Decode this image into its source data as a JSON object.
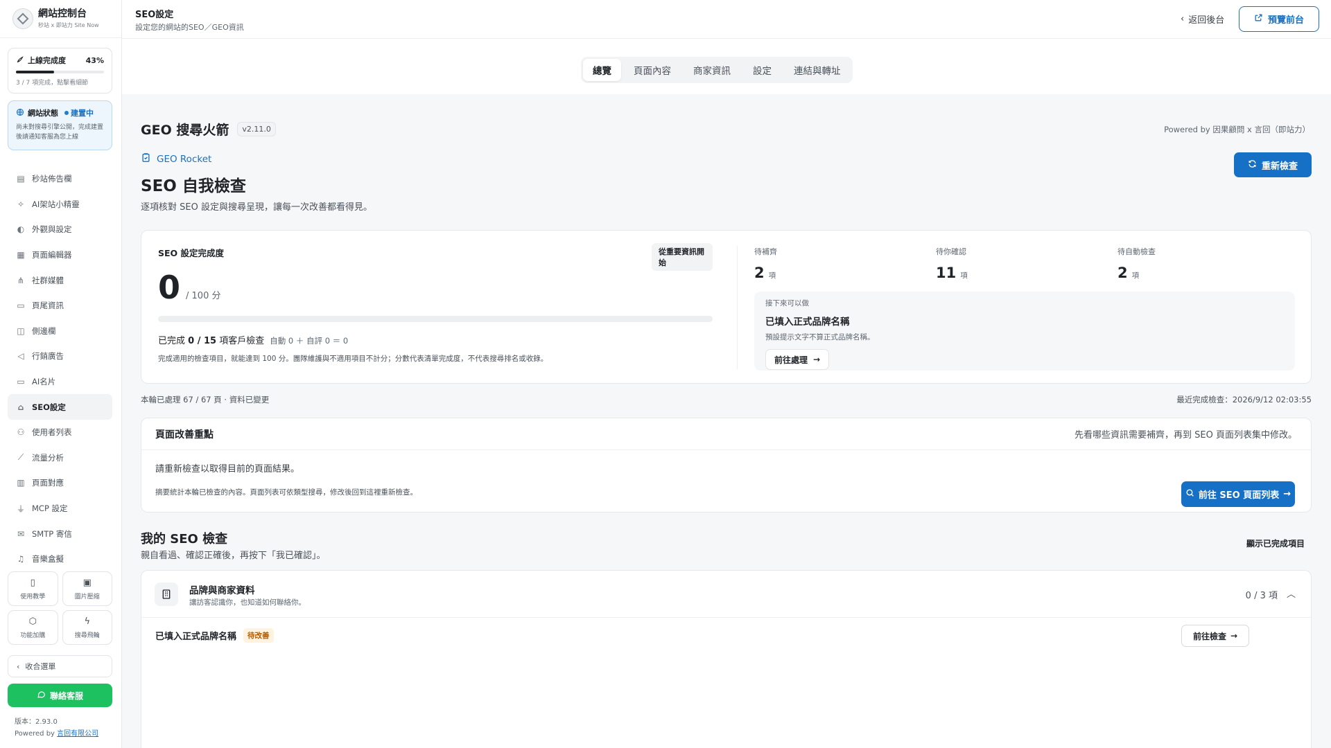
{
  "sidebar": {
    "brand_title": "網站控制台",
    "brand_sub": "秒站 x 即站力 Site Now",
    "progress": {
      "title": "上線完成度",
      "percent_label": "43%",
      "percent": 0.43,
      "note": "3 / 7 項完成，點擊看細節"
    },
    "status": {
      "title": "網站狀態",
      "badge": "建置中",
      "note": "尚未對搜尋引擎公開，完成建置後請通知客服為您上線"
    },
    "items": [
      {
        "label": "秒站佈告欄",
        "icon": "clipboard-icon"
      },
      {
        "label": "AI架站小精靈",
        "icon": "sparkle-icon"
      },
      {
        "label": "外觀與設定",
        "icon": "palette-icon"
      },
      {
        "label": "頁面編輯器",
        "icon": "layout-icon"
      },
      {
        "label": "社群媒體",
        "icon": "share-icon"
      },
      {
        "label": "頁尾資訊",
        "icon": "footer-icon"
      },
      {
        "label": "側邊欄",
        "icon": "sidebar-icon"
      },
      {
        "label": "行銷廣告",
        "icon": "megaphone-icon"
      },
      {
        "label": "AI名片",
        "icon": "card-icon"
      },
      {
        "label": "SEO設定",
        "icon": "rocket-icon",
        "active": true
      },
      {
        "label": "使用者列表",
        "icon": "users-icon"
      },
      {
        "label": "流量分析",
        "icon": "chart-icon"
      },
      {
        "label": "頁面對應",
        "icon": "map-icon"
      },
      {
        "label": "MCP 設定",
        "icon": "plug-icon"
      },
      {
        "label": "SMTP 寄信",
        "icon": "mail-icon"
      },
      {
        "label": "音樂盒擬",
        "icon": "music-icon"
      }
    ],
    "tiles": [
      {
        "label": "使用教學",
        "icon": "book-icon"
      },
      {
        "label": "圖片壓縮",
        "icon": "image-icon"
      },
      {
        "label": "功能加購",
        "icon": "package-icon"
      },
      {
        "label": "搜尋飛輪",
        "icon": "bolt-icon"
      }
    ],
    "collapse_label": "收合選單",
    "contact_label": "聯絡客服",
    "version_label": "版本：2.93.0",
    "powered_prefix": "Powered by",
    "powered_link": "言回有限公司"
  },
  "header": {
    "title": "SEO設定",
    "subtitle": "設定您的網站的SEO／GEO資訊",
    "back_label": "返回後台",
    "preview_label": "預覽前台"
  },
  "tabs": [
    {
      "label": "總覽",
      "active": true
    },
    {
      "label": "頁面內容"
    },
    {
      "label": "商家資訊"
    },
    {
      "label": "設定"
    },
    {
      "label": "連結與轉址"
    }
  ],
  "geo": {
    "title": "GEO 搜尋火箭",
    "version": "v2.11.0",
    "powered": "Powered by 因果顧問 x 言回（即站力）"
  },
  "check": {
    "rocket_label": "GEO Rocket",
    "title": "SEO 自我檢查",
    "subtitle": "逐項核對 SEO 設定與搜尋呈現，讓每一次改善都看得見。",
    "recheck_label": "重新檢查"
  },
  "score": {
    "label": "SEO 設定完成度",
    "start_badge": "從重要資訊開始",
    "value": "0",
    "max_label": "/ 100 分",
    "progress": 0,
    "done_prefix": "已完成",
    "done_count": "0 / 15",
    "done_suffix": "項客戶檢查",
    "done_auto": "自動 0 ＋ 自評 0 ＝ 0",
    "note": "完成適用的檢查項目，就能達到 100 分。團隊維護與不適用項目不計分；分數代表清單完成度，不代表搜尋排名或收錄。"
  },
  "stats": [
    {
      "label": "待補齊",
      "value": "2",
      "unit": "項"
    },
    {
      "label": "待你確認",
      "value": "11",
      "unit": "項"
    },
    {
      "label": "待自動檢查",
      "value": "2",
      "unit": "項"
    }
  ],
  "next": {
    "label": "接下來可以做",
    "title": "已填入正式品牌名稱",
    "note": "預設提示文字不算正式品牌名稱。",
    "button": "前往處理"
  },
  "meta": {
    "processed": "本輪已處理 67 / 67 頁 · 資料已變更",
    "last_check": "最近完成檢查：2026/9/12 02:03:55"
  },
  "improve": {
    "title": "頁面改善重點",
    "hint": "先看哪些資訊需要補齊，再到 SEO 頁面列表集中修改。",
    "body": "請重新檢查以取得目前的頁面結果。",
    "note": "摘要統計本輪已檢查的內容。頁面列表可依類型搜尋，修改後回到這裡重新檢查。",
    "button": "前往 SEO 頁面列表"
  },
  "my_check": {
    "title": "我的 SEO 檢查",
    "subtitle": "親自看過、確認正確後，再按下「我已確認」。",
    "show_done": "顯示已完成項目"
  },
  "brand_section": {
    "title": "品牌與商家資料",
    "subtitle": "讓訪客認識你，也知道如何聯絡你。",
    "count": "0 / 3 項",
    "item_title": "已填入正式品牌名稱",
    "item_badge": "待改善",
    "item_button": "前往檢查"
  }
}
